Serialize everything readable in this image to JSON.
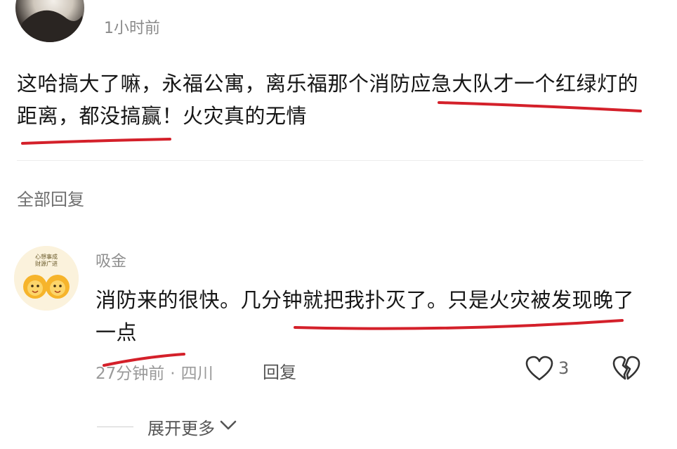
{
  "post": {
    "username": "",
    "time": "1小时前",
    "text": "这哈搞大了嘛，永福公寓，离乐福那个消防应急大队才一个红绿灯的距离，都没搞赢！火灾真的无情"
  },
  "replies_header": "全部回复",
  "reply": {
    "username": "吸金",
    "text": "消防来的很快。几分钟就把我扑灭了。只是火灾被发现晚了一点",
    "time": "27分钟前",
    "separator": "·",
    "location": "四川",
    "reply_label": "回复",
    "like_count": "3"
  },
  "expand_label": "展开更多",
  "colors": {
    "underline": "#d4202a",
    "text": "#161616",
    "muted": "#8a8a8a"
  },
  "icons": {
    "like": "heart-outline-icon",
    "dislike": "broken-heart-icon",
    "expand": "chevron-down-icon"
  }
}
